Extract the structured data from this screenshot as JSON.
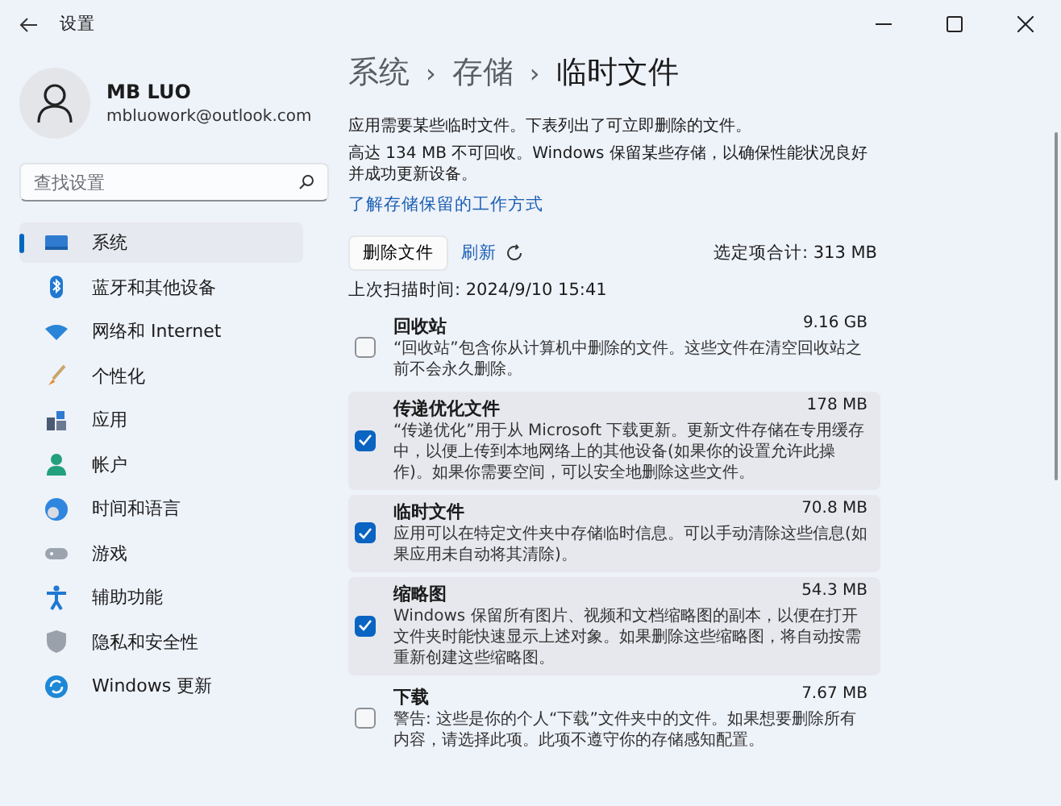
{
  "window": {
    "title": "设置"
  },
  "account": {
    "name": "MB LUO",
    "email": "mbluowork@outlook.com"
  },
  "search": {
    "placeholder": "查找设置"
  },
  "sidebar": {
    "items": [
      {
        "label": "系统",
        "selected": true
      },
      {
        "label": "蓝牙和其他设备",
        "selected": false
      },
      {
        "label": "网络和 Internet",
        "selected": false
      },
      {
        "label": "个性化",
        "selected": false
      },
      {
        "label": "应用",
        "selected": false
      },
      {
        "label": "帐户",
        "selected": false
      },
      {
        "label": "时间和语言",
        "selected": false
      },
      {
        "label": "游戏",
        "selected": false
      },
      {
        "label": "辅助功能",
        "selected": false
      },
      {
        "label": "隐私和安全性",
        "selected": false
      },
      {
        "label": "Windows 更新",
        "selected": false
      }
    ]
  },
  "breadcrumb": [
    "系统",
    "存储",
    "临时文件"
  ],
  "breadcrumb_separators": [
    "›",
    "›"
  ],
  "intro": "应用需要某些临时文件。下表列出了可立即删除的文件。",
  "reserve_note": "高达 134 MB 不可回收。Windows 保留某些存储，以确保性能状况良好并成功更新设备。",
  "learn_link": "了解存储保留的工作方式",
  "delete_button": "删除文件",
  "refresh_link": "刷新",
  "selected_total": "选定项合计: 313 MB",
  "last_scan": "上次扫描时间: 2024/9/10 15:41",
  "items": [
    {
      "title": "回收站",
      "size": "9.16 GB",
      "description": "“回收站”包含你从计算机中删除的文件。这些文件在清空回收站之前不会永久删除。",
      "checked": false
    },
    {
      "title": "传递优化文件",
      "size": "178 MB",
      "description": "“传递优化”用于从 Microsoft 下载更新。更新文件存储在专用缓存中，以便上传到本地网络上的其他设备(如果你的设置允许此操作)。如果你需要空间，可以安全地删除这些文件。",
      "checked": true
    },
    {
      "title": "临时文件",
      "size": "70.8 MB",
      "description": "应用可以在特定文件夹中存储临时信息。可以手动清除这些信息(如果应用未自动将其清除)。",
      "checked": true
    },
    {
      "title": "缩略图",
      "size": "54.3 MB",
      "description": "Windows 保留所有图片、视频和文档缩略图的副本，以便在打开文件夹时能快速显示上述对象。如果删除这些缩略图，将自动按需重新创建这些缩略图。",
      "checked": true
    },
    {
      "title": "下载",
      "size": "7.67 MB",
      "description": "警告: 这些是你的个人“下载”文件夹中的文件。如果想要删除所有内容，请选择此项。此项不遵守你的存储感知配置。",
      "checked": false
    }
  ]
}
